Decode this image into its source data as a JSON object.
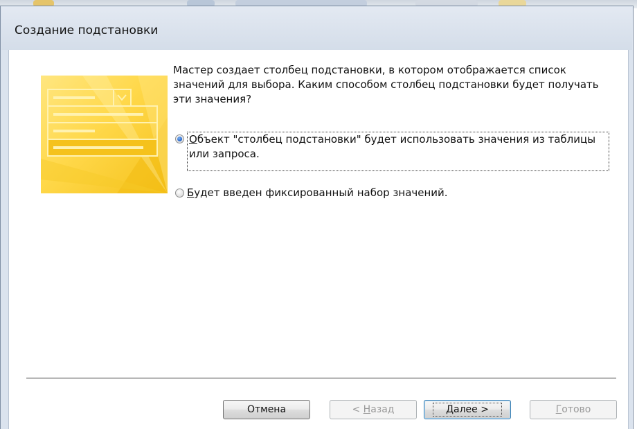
{
  "dialog": {
    "title": "Создание подстановки",
    "description": "Мастер создает столбец подстановки, в котором отображается список значений для выбора.  Каким способом столбец подстановки будет получать эти значения?",
    "options": [
      {
        "prefix": "",
        "accesskey": "О",
        "rest": "бъект \"столбец подстановки\" будет использовать значения из таблицы или запроса.",
        "checked": true
      },
      {
        "prefix": "",
        "accesskey": "Б",
        "rest": "удет введен фиксированный набор значений.",
        "checked": false
      }
    ],
    "buttons": {
      "cancel": {
        "label": "Отмена"
      },
      "back": {
        "prefix": "< ",
        "accesskey": "Н",
        "rest": "азад",
        "disabled": true
      },
      "next": {
        "accesskey": "Д",
        "rest": "алее >",
        "default": true
      },
      "finish": {
        "accesskey": "Г",
        "rest": "отово",
        "disabled": true
      }
    }
  },
  "colors": {
    "accent_radio": "#2a6bd1",
    "illustration_yellow": "#ffd84a",
    "illustration_shadow": "#f5c21c",
    "default_button_border": "#3c7fb1"
  }
}
